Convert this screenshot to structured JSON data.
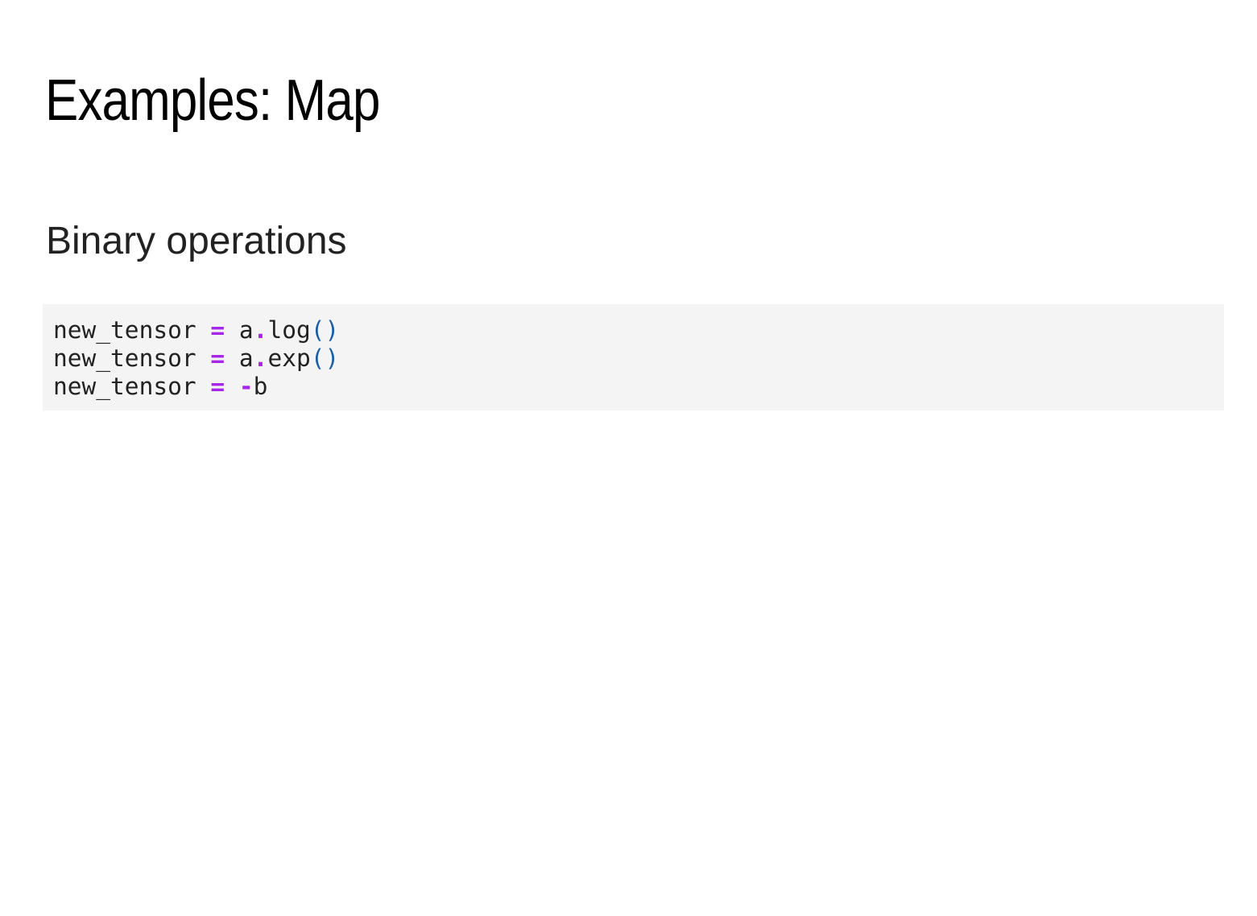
{
  "slide": {
    "title": "Examples: Map",
    "subtitle": "Binary operations"
  },
  "code": {
    "lines": [
      [
        {
          "text": "new_tensor ",
          "kind": "plain"
        },
        {
          "text": "=",
          "kind": "op"
        },
        {
          "text": " a",
          "kind": "plain"
        },
        {
          "text": ".",
          "kind": "op"
        },
        {
          "text": "log",
          "kind": "plain"
        },
        {
          "text": "()",
          "kind": "paren"
        }
      ],
      [
        {
          "text": "new_tensor ",
          "kind": "plain"
        },
        {
          "text": "=",
          "kind": "op"
        },
        {
          "text": " a",
          "kind": "plain"
        },
        {
          "text": ".",
          "kind": "op"
        },
        {
          "text": "exp",
          "kind": "plain"
        },
        {
          "text": "()",
          "kind": "paren"
        }
      ],
      [
        {
          "text": "new_tensor ",
          "kind": "plain"
        },
        {
          "text": "=",
          "kind": "op"
        },
        {
          "text": " ",
          "kind": "plain"
        },
        {
          "text": "-",
          "kind": "op"
        },
        {
          "text": "b",
          "kind": "plain"
        }
      ]
    ]
  },
  "colors": {
    "operator": "#a626e8",
    "paren": "#1a5fa8",
    "text": "#222222",
    "code_background": "#f4f4f4"
  }
}
